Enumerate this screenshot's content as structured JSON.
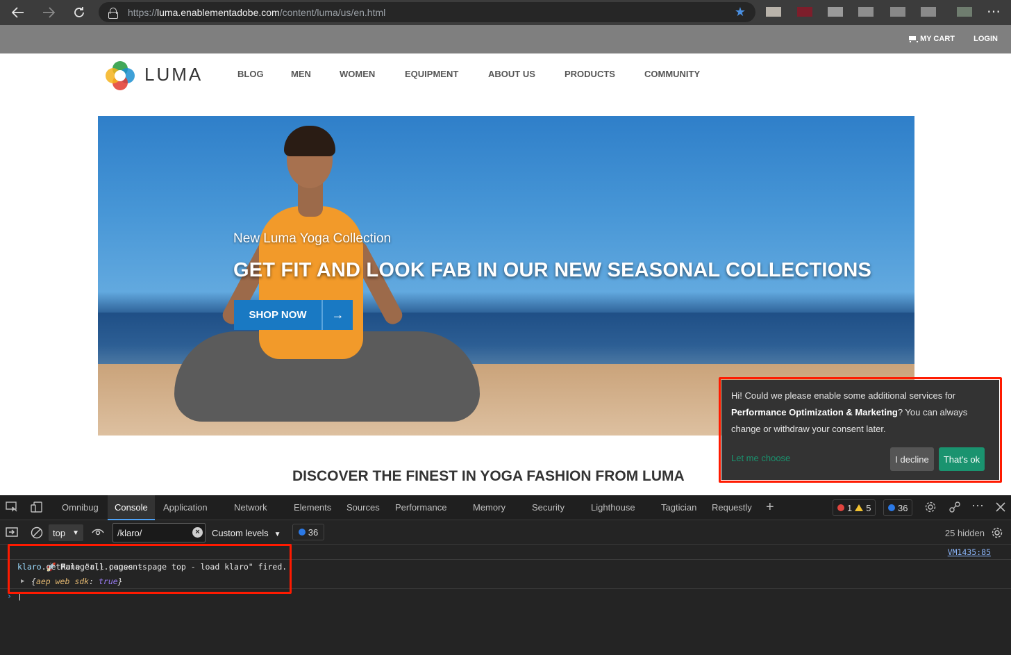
{
  "browser": {
    "url_prefix": "https://",
    "url_domain": "luma.enablementadobe.com",
    "url_path": "/content/luma/us/en.html",
    "more_glyph": "⋯"
  },
  "site": {
    "topbar": {
      "cart": "MY CART",
      "login": "LOGIN"
    },
    "logo": "LUMA",
    "menu": [
      "BLOG",
      "MEN",
      "WOMEN",
      "EQUIPMENT",
      "ABOUT US",
      "PRODUCTS",
      "COMMUNITY"
    ],
    "hero": {
      "subtitle": "New Luma Yoga Collection",
      "title": "GET FIT AND LOOK FAB IN OUR NEW SEASONAL COLLECTIONS",
      "button": "SHOP NOW",
      "button_arrow": "→"
    },
    "discover": "DISCOVER THE FINEST IN YOGA FASHION FROM LUMA"
  },
  "consent": {
    "text_1": "Hi! Could we please enable some additional services for ",
    "text_bold": "Performance Optimization & Marketing",
    "text_2": "? You can always change or withdraw your consent later.",
    "let_me_choose": "Let me choose",
    "decline": "I decline",
    "accept": "That's ok",
    "accent_color": "#1a936f",
    "highlight_color": "#ff1a00"
  },
  "devtools": {
    "tabs": [
      "Omnibug",
      "Console",
      "Application",
      "Network",
      "Elements",
      "Sources",
      "Performance",
      "Memory",
      "Security",
      "Lighthouse",
      "Tagtician",
      "Requestly"
    ],
    "active_tab": "Console",
    "counts": {
      "errors": "1",
      "warnings": "5",
      "messages": "36"
    },
    "context": "top",
    "filter": "/klaro/",
    "levels": "Custom levels",
    "filtered_count": "36",
    "hidden": "25 hidden",
    "console": {
      "line1": "🚀 Rule \"all pages - page top - load klaro\" fired.",
      "line1_source": "VM1435:85",
      "line2_obj": "klaro",
      "line2_rest": ".getManager().consents",
      "line3_key": "aep web sdk",
      "line3_val": "true"
    }
  }
}
